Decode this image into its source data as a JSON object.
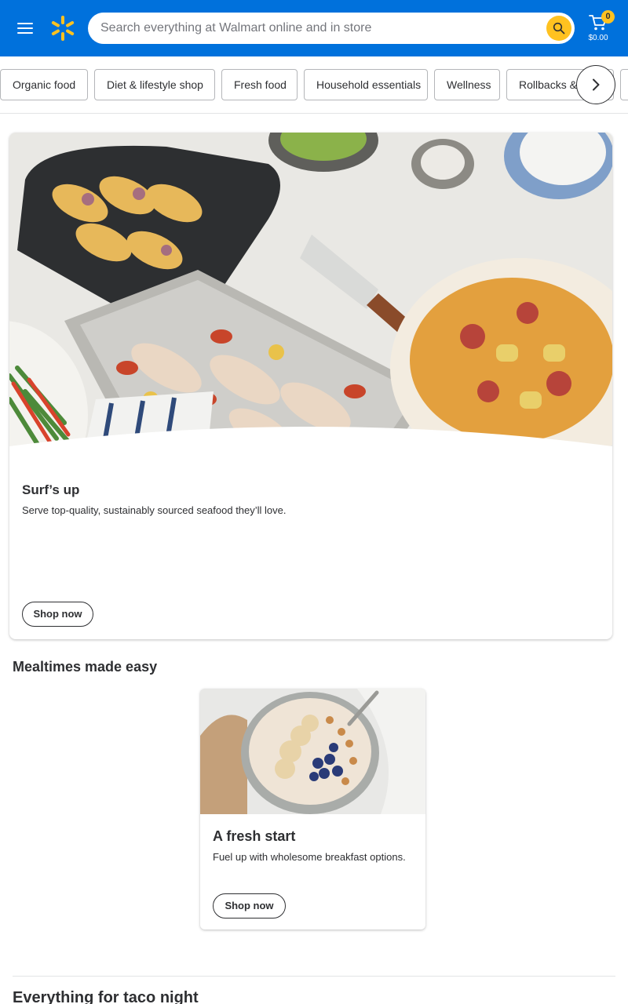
{
  "header": {
    "menu_icon": "hamburger-menu-icon",
    "logo_icon": "walmart-spark-logo",
    "search_placeholder": "Search everything at Walmart online and in store",
    "search_icon": "search-icon",
    "cart_icon": "cart-icon",
    "cart_count": "0",
    "cart_total": "$0.00",
    "colors": {
      "brand_blue": "#0071dc",
      "accent_yellow": "#ffc220"
    }
  },
  "categories": {
    "items": [
      {
        "label": "Organic food"
      },
      {
        "label": "Diet & lifestyle shop"
      },
      {
        "label": "Fresh food"
      },
      {
        "label": "Household essentials"
      },
      {
        "label": "Wellness"
      },
      {
        "label": "Rollbacks & more"
      }
    ],
    "next_icon": "chevron-right-icon"
  },
  "hero": {
    "title": "Surf’s up",
    "subtitle": "Serve top-quality, sustainably sourced seafood they’ll love.",
    "button_label": "Shop now"
  },
  "mealtimes": {
    "heading": "Mealtimes made easy",
    "card": {
      "title": "A fresh start",
      "subtitle": "Fuel up with wholesome breakfast options.",
      "button_label": "Shop now"
    }
  },
  "taco": {
    "heading": "Everything for taco night"
  }
}
